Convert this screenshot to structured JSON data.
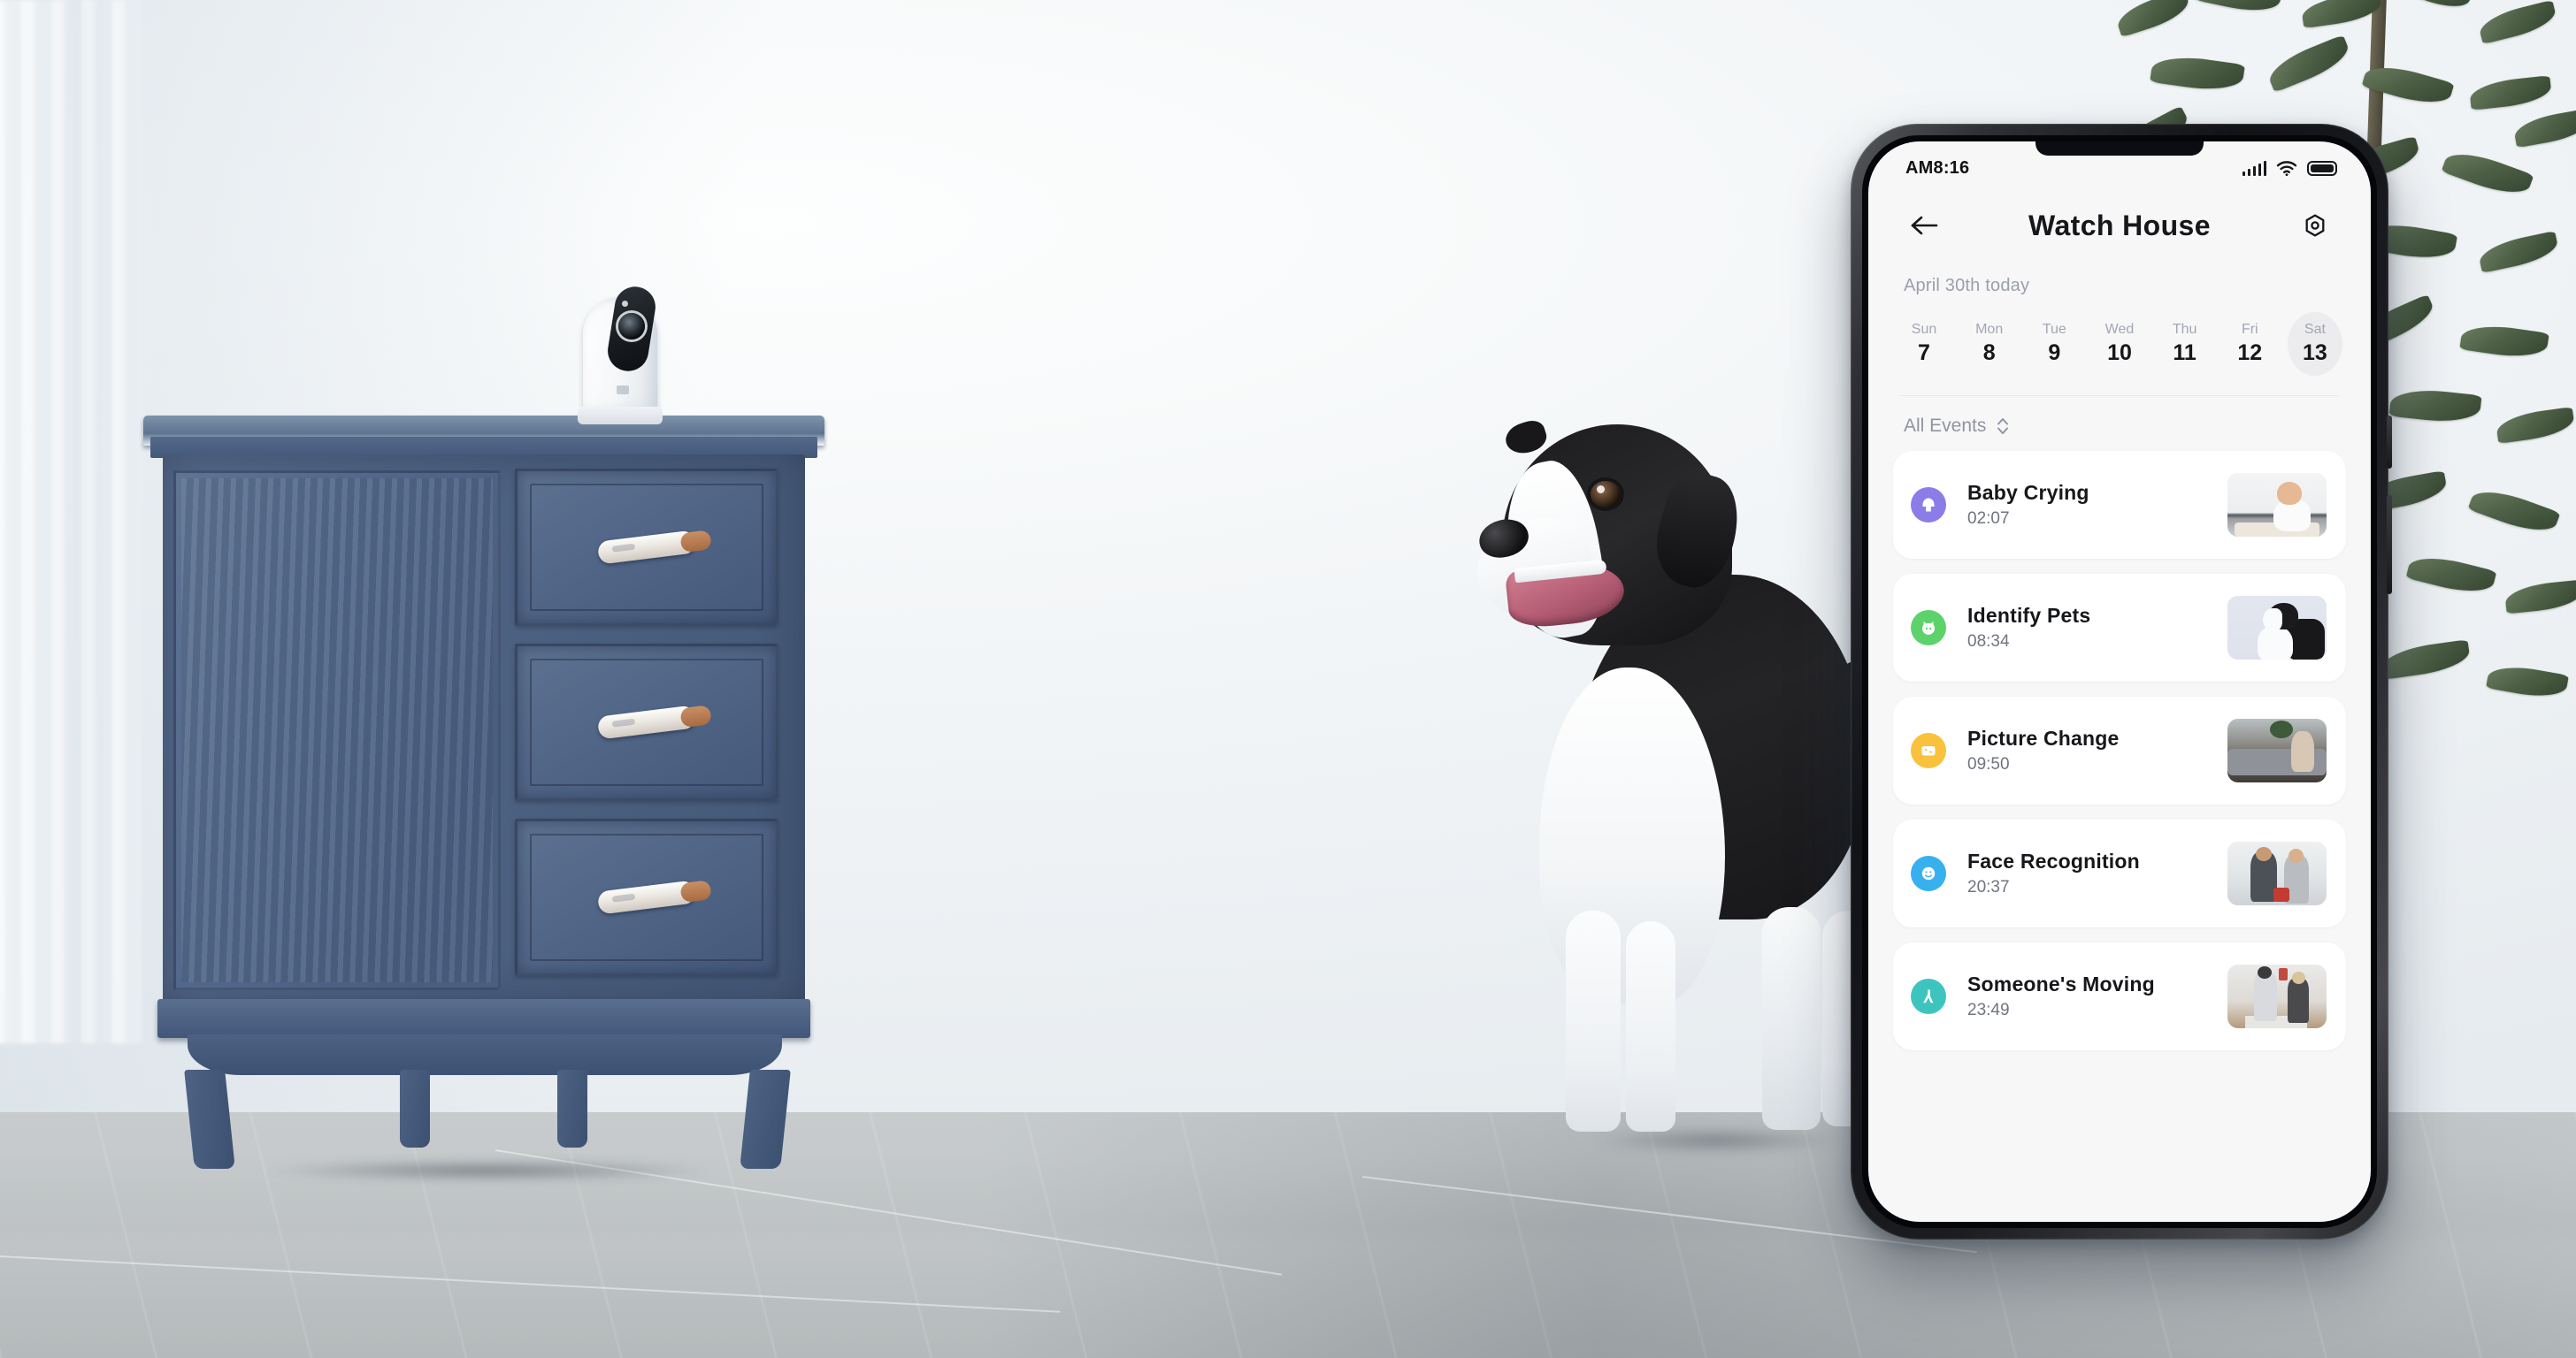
{
  "scene": {
    "description": "living room with blue distressed nightstand, security camera, border collie dog, plant",
    "objects": [
      "wall",
      "curtain",
      "floor",
      "cabinet",
      "camera",
      "dog",
      "plant"
    ]
  },
  "phone": {
    "statusbar": {
      "time": "AM8:16",
      "icons": [
        "signal-icon",
        "wifi-icon",
        "battery-icon"
      ]
    },
    "header": {
      "back_icon": "arrow-left-icon",
      "title": "Watch  House",
      "settings_icon": "settings-nut-icon"
    },
    "today_label": "April 30th  today",
    "dates": [
      {
        "dow": "Sun",
        "num": "7",
        "active": false
      },
      {
        "dow": "Mon",
        "num": "8",
        "active": false
      },
      {
        "dow": "Tue",
        "num": "9",
        "active": false
      },
      {
        "dow": "Wed",
        "num": "10",
        "active": false
      },
      {
        "dow": "Thu",
        "num": "11",
        "active": false
      },
      {
        "dow": "Fri",
        "num": "12",
        "active": false
      },
      {
        "dow": "Sat",
        "num": "13",
        "active": true
      }
    ],
    "filter": {
      "label": "All Events",
      "icon": "chevron-updown-icon"
    },
    "events": [
      {
        "title": "Baby Crying",
        "time": "02:07",
        "icon": "baby-icon",
        "color": "#8b7de8",
        "thumb": "baby-sitting-on-floor"
      },
      {
        "title": "Identify Pets",
        "time": "08:34",
        "icon": "pet-icon",
        "color": "#5ed26a",
        "thumb": "border-collie-dog"
      },
      {
        "title": "Picture Change",
        "time": "09:50",
        "icon": "picture-icon",
        "color": "#f9c13c",
        "thumb": "woman-on-sofa"
      },
      {
        "title": "Face Recognition",
        "time": "20:37",
        "icon": "face-icon",
        "color": "#37b0ee",
        "thumb": "couple-in-kitchen"
      },
      {
        "title": "Someone's Moving",
        "time": "23:49",
        "icon": "walking-icon",
        "color": "#3ec4be",
        "thumb": "pillow-fight-bedroom"
      }
    ],
    "colors": {
      "screen_bg": "#f7f7f8",
      "card_bg": "#ffffff",
      "text_primary": "#16171a",
      "text_secondary": "#6f7480",
      "text_muted": "#9aa0ab",
      "active_pill": "#ececee",
      "frame": "#1c1d21"
    }
  }
}
